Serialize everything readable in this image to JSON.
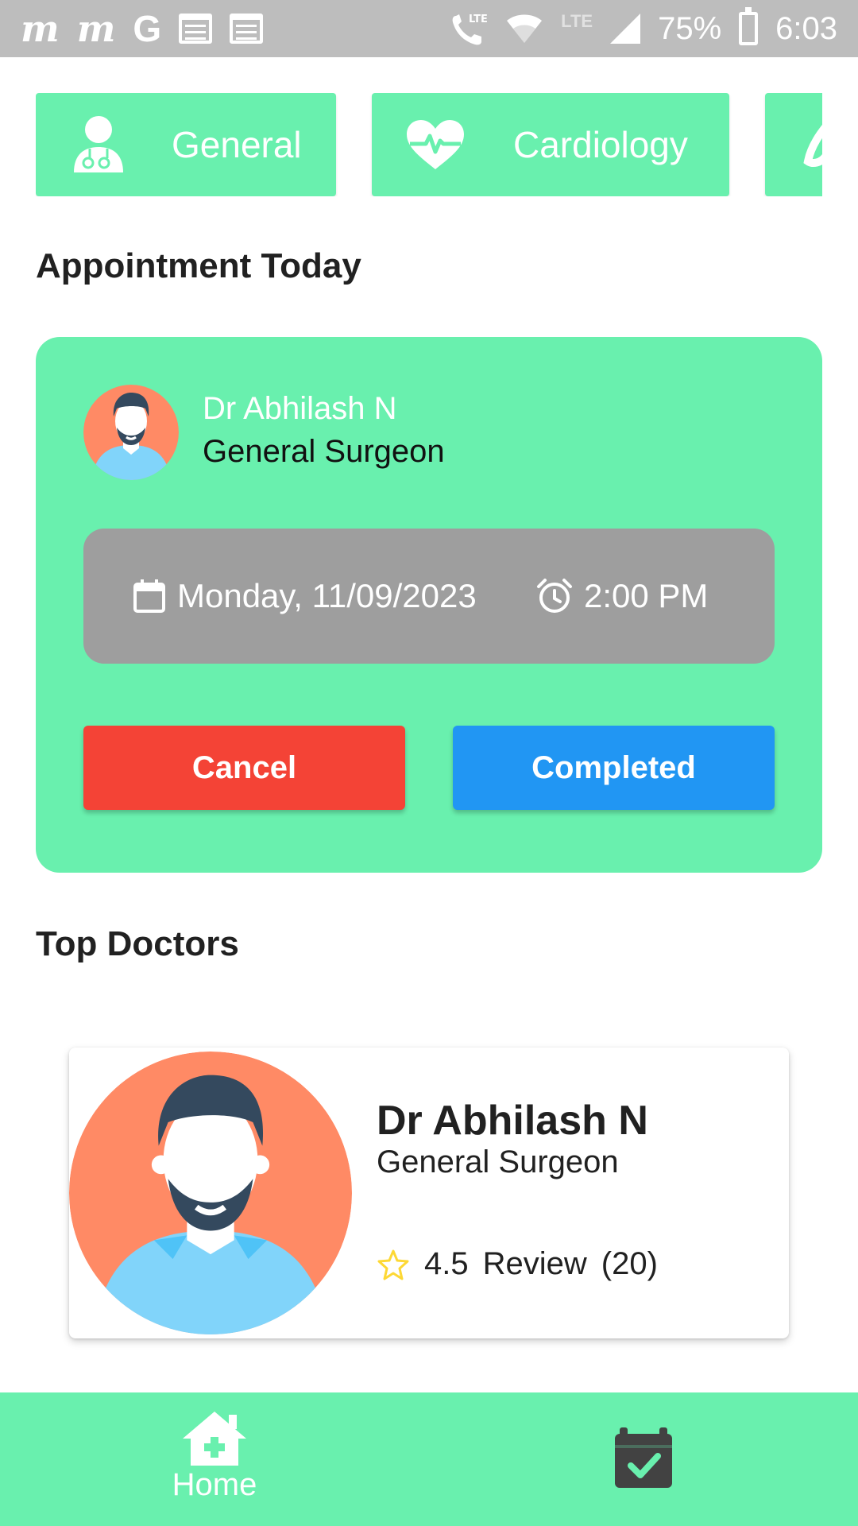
{
  "status_bar": {
    "app_icons": [
      "m",
      "m",
      "G"
    ],
    "lte_label": "LTE",
    "battery": "75%",
    "time": "6:03"
  },
  "categories": [
    {
      "label": "General",
      "icon": "doctor-icon"
    },
    {
      "label": "Cardiology",
      "icon": "heartbeat-icon"
    },
    {
      "label": "",
      "icon": "partial-category-icon"
    }
  ],
  "appointment_section": {
    "title": "Appointment Today",
    "doctor_name": "Dr Abhilash N",
    "specialty": "General Surgeon",
    "date": "Monday, 11/09/2023",
    "time": "2:00 PM",
    "cancel_label": "Cancel",
    "completed_label": "Completed"
  },
  "top_doctors": {
    "title": "Top Doctors",
    "doctors": [
      {
        "name": "Dr Abhilash N",
        "specialty": "General Surgeon",
        "rating": "4.5",
        "review_label": "Review",
        "review_count": "(20)"
      }
    ]
  },
  "bottom_nav": {
    "home_label": "Home",
    "appointments_icon": "calendar-check-icon"
  },
  "colors": {
    "accent_green": "#69f0ae",
    "cancel_red": "#f44336",
    "completed_blue": "#2196f3",
    "datetime_gray": "#9e9e9e",
    "avatar_bg": "#ff8a65",
    "star": "#fdd835"
  }
}
